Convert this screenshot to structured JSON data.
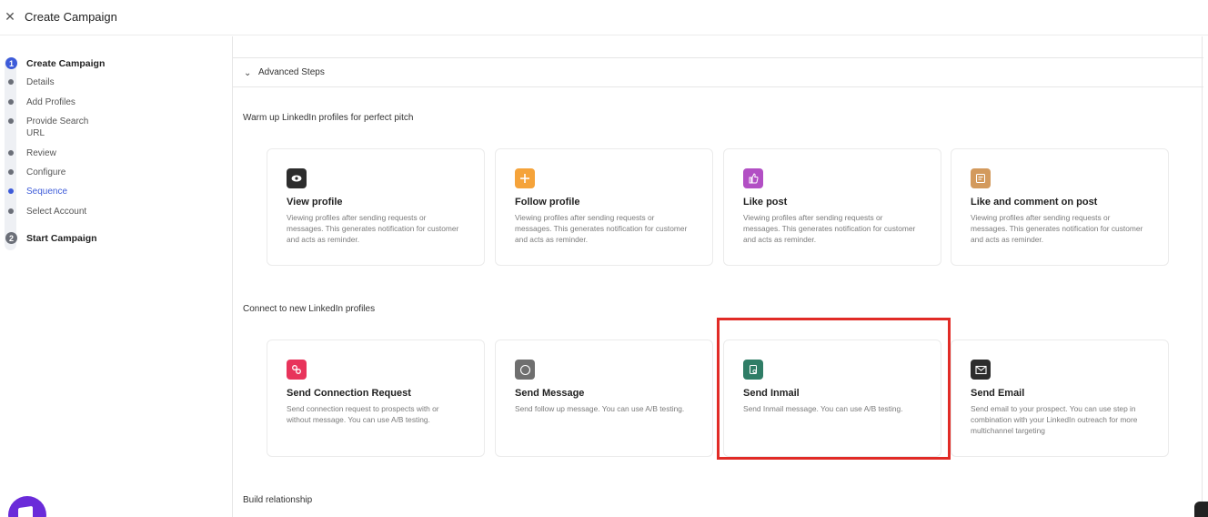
{
  "topbar": {
    "title": "Create Campaign"
  },
  "sidebar": {
    "steps": [
      {
        "num": "1",
        "label": "Create Campaign"
      },
      {
        "num": "2",
        "label": "Start Campaign"
      }
    ],
    "substeps": [
      {
        "label": "Details"
      },
      {
        "label": "Add Profiles"
      },
      {
        "label": "Provide Search URL"
      },
      {
        "label": "Review"
      },
      {
        "label": "Configure"
      },
      {
        "label": "Sequence"
      },
      {
        "label": "Select Account"
      }
    ]
  },
  "main": {
    "advanced_title": "Advanced Steps",
    "sections": [
      {
        "title": "Warm up LinkedIn profiles for perfect pitch",
        "cards": [
          {
            "title": "View profile",
            "desc": "Viewing profiles after sending requests or messages. This generates notification for customer and acts as reminder.",
            "icon": "eye-icon",
            "color": "#2d2d2d"
          },
          {
            "title": "Follow profile",
            "desc": "Viewing profiles after sending requests or messages. This generates notification for customer and acts as reminder.",
            "icon": "plus-icon",
            "color": "#f5a33a"
          },
          {
            "title": "Like post",
            "desc": "Viewing profiles after sending requests or messages. This generates notification for customer and acts as reminder.",
            "icon": "thumbs-up-icon",
            "color": "#b24fc4"
          },
          {
            "title": "Like and comment on post",
            "desc": "Viewing profiles after sending requests or messages. This generates notification for customer and acts as reminder.",
            "icon": "comment-icon",
            "color": "#d39a5d"
          }
        ]
      },
      {
        "title": "Connect to new LinkedIn profiles",
        "cards": [
          {
            "title": "Send Connection Request",
            "desc": "Send connection request to prospects with or without message. You can use A/B testing.",
            "icon": "link-icon",
            "color": "#e8345b"
          },
          {
            "title": "Send Message",
            "desc": "Send follow up message. You can use A/B testing.",
            "icon": "chat-icon",
            "color": "#6f6f6f"
          },
          {
            "title": "Send Inmail",
            "desc": "Send Inmail message. You can use A/B testing.",
            "icon": "inmail-icon",
            "color": "#2f7d66"
          },
          {
            "title": "Send Email",
            "desc": "Send email to your prospect. You can use step in combination with your LinkedIn outreach for more multichannel targeting",
            "icon": "envelope-icon",
            "color": "#2d2d2d"
          }
        ]
      },
      {
        "title": "Build relationship",
        "cards": []
      }
    ]
  },
  "colors": {
    "accent": "#3d5bd9",
    "highlight": "#e12b26",
    "chat": "#6a2bd9"
  }
}
